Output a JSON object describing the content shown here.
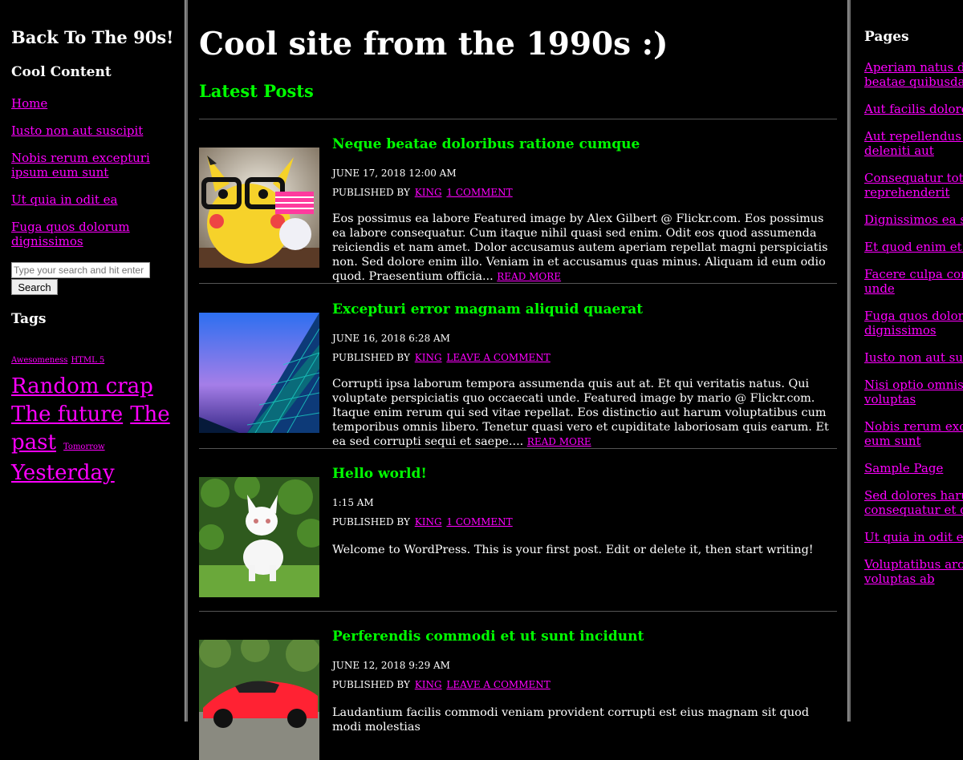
{
  "left_sidebar": {
    "site_title": "Back To The 90s!",
    "cool_content_heading": "Cool Content",
    "nav": [
      "Home",
      "Iusto non aut suscipit",
      "Nobis rerum excepturi ipsum eum sunt",
      "Ut quia in odit ea",
      "Fuga quos dolorum dignissimos"
    ],
    "search": {
      "placeholder": "Type your search and hit enter",
      "button": "Search"
    },
    "tags_heading": "Tags",
    "tags": [
      "Awesomeness",
      "HTML 5",
      "Random crap",
      "The future",
      "The past",
      "Tomorrow",
      "Yesterday"
    ]
  },
  "main": {
    "title": "Cool site from the 1990s :)",
    "latest_heading": "Latest Posts",
    "published_by": "PUBLISHED BY",
    "posts": [
      {
        "title": "Neque beatae doloribus ratione cumque",
        "date": "JUNE 17, 2018 12:00 AM",
        "author": "KING",
        "comments": "1 COMMENT",
        "excerpt": "Eos possimus ea labore Featured image by Alex Gilbert @ Flickr.com. Eos possimus ea labore consequatur. Cum itaque nihil quasi sed enim. Odit eos quod assumenda reiciendis et nam amet. Dolor accusamus autem aperiam repellat magni perspiciatis non. Sed dolore enim illo. Veniam in et accusamus quas minus. Aliquam id eum odio quod. Praesentium officia...",
        "read_more": "READ MORE",
        "image": "pikachu-plush-with-glasses"
      },
      {
        "title": "Excepturi error magnam aliquid quaerat",
        "date": "JUNE 16, 2018 6:28 AM",
        "author": "KING",
        "comments": "LEAVE A COMMENT",
        "excerpt": "Corrupti ipsa laborum tempora assumenda quis aut at. Et qui veritatis natus. Qui voluptate perspiciatis quo occaecati unde. Featured image by mario @ Flickr.com. Itaque enim rerum qui sed vitae repellat. Eos distinctio aut harum voluptatibus cum temporibus omnis libero. Tenetur quasi vero et cupiditate laboriosam quis earum. Et ea sed corrupti sequi et saepe....",
        "read_more": "READ MORE",
        "image": "glass-building"
      },
      {
        "title": "Hello world!",
        "date": "1:15 AM",
        "author": "KING",
        "comments": "1 COMMENT",
        "excerpt": "Welcome to WordPress. This is your first post. Edit or delete it, then start writing!",
        "read_more": "",
        "image": "white-kitten"
      },
      {
        "title": "Perferendis commodi et ut sunt incidunt",
        "date": "JUNE 12, 2018 9:29 AM",
        "author": "KING",
        "comments": "LEAVE A COMMENT",
        "excerpt": "Laudantium facilis commodi veniam provident corrupti est eius magnam sit quod modi molestias",
        "read_more": "",
        "image": "red-sports-car"
      }
    ]
  },
  "right_sidebar": {
    "pages_heading": "Pages",
    "pages": [
      "Aperiam natus debitis beatae quibusdam qui",
      "Aut facilis dolores et",
      "Aut repellendus quos deleniti aut",
      "Consequatur totam reprehenderit",
      "Dignissimos ea sit",
      "Et quod enim et harum",
      "Facere culpa consequatur unde",
      "Fuga quos dolorum dignissimos",
      "Iusto non aut suscipit",
      "Nisi optio omnis sit voluptas",
      "Nobis rerum excepturi eum sunt",
      "Sample Page",
      "Sed dolores harum consequatur et quo",
      "Ut quia in odit ea",
      "Voluptatibus architecto voluptas ab"
    ]
  },
  "colors": {
    "background": "#000000",
    "link": "#ff00ff",
    "heading_green": "#00ff00",
    "text": "#ffffff"
  }
}
